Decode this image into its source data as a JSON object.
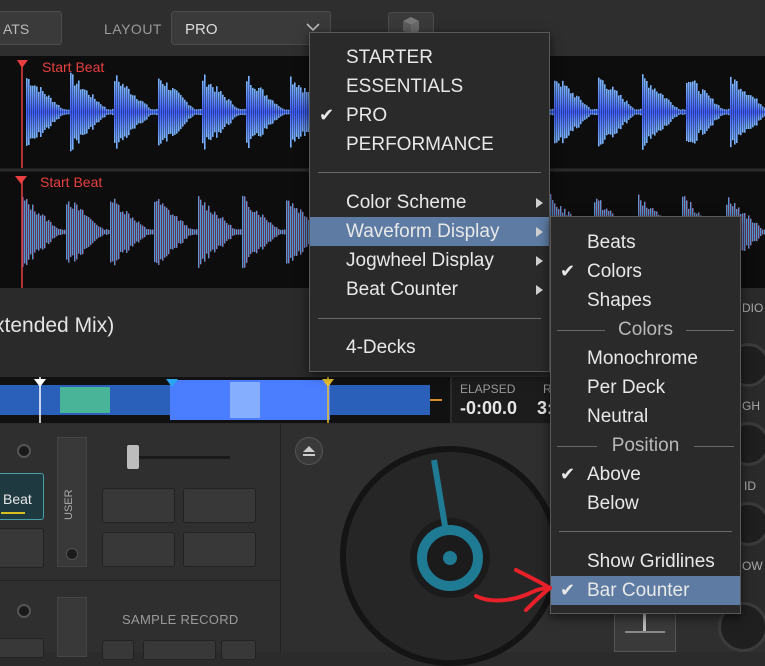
{
  "toolbar": {
    "beats_btn": "ATS",
    "layout_label": "LAYOUT",
    "layout_value": "PRO"
  },
  "waveform": {
    "deck1_marker": "Start Beat",
    "deck2_marker": "Start Beat"
  },
  "track": {
    "title": "xtended Mix)"
  },
  "time": {
    "elapsed_label": "ELAPSED",
    "elapsed_value": "-0:00.0",
    "remain_label": "R",
    "remain_value": "3:"
  },
  "deck": {
    "beat_pad": "Beat",
    "user_tab": "USER",
    "sample_record": "SAMPLE RECORD",
    "right_labels": [
      "DIO",
      "GH",
      "ID",
      "OW"
    ]
  },
  "layout_menu": {
    "items": [
      {
        "label": "STARTER",
        "checked": false
      },
      {
        "label": "ESSENTIALS",
        "checked": false
      },
      {
        "label": "PRO",
        "checked": true
      },
      {
        "label": "PERFORMANCE",
        "checked": false
      }
    ],
    "submenus": [
      {
        "label": "Color Scheme",
        "highlighted": false
      },
      {
        "label": "Waveform Display",
        "highlighted": true
      },
      {
        "label": "Jogwheel Display",
        "highlighted": false
      },
      {
        "label": "Beat Counter",
        "highlighted": false
      }
    ],
    "decks": "4-Decks"
  },
  "waveform_menu": {
    "top_items": [
      {
        "label": "Beats",
        "checked": false
      },
      {
        "label": "Colors",
        "checked": true
      },
      {
        "label": "Shapes",
        "checked": false
      }
    ],
    "colors_header": "Colors",
    "color_items": [
      {
        "label": "Monochrome",
        "checked": false
      },
      {
        "label": "Per Deck",
        "checked": false
      },
      {
        "label": "Neutral",
        "checked": false
      }
    ],
    "position_header": "Position",
    "position_items": [
      {
        "label": "Above",
        "checked": true
      },
      {
        "label": "Below",
        "checked": false
      }
    ],
    "bottom_items": [
      {
        "label": "Show Gridlines",
        "checked": false,
        "highlighted": false
      },
      {
        "label": "Bar Counter",
        "checked": true,
        "highlighted": true
      }
    ]
  },
  "colors": {
    "highlight": "#5d7ba3",
    "accent_cyan": "#2aa6b8",
    "marker_red": "#e84040",
    "annotation_arrow": "#e8202a"
  }
}
